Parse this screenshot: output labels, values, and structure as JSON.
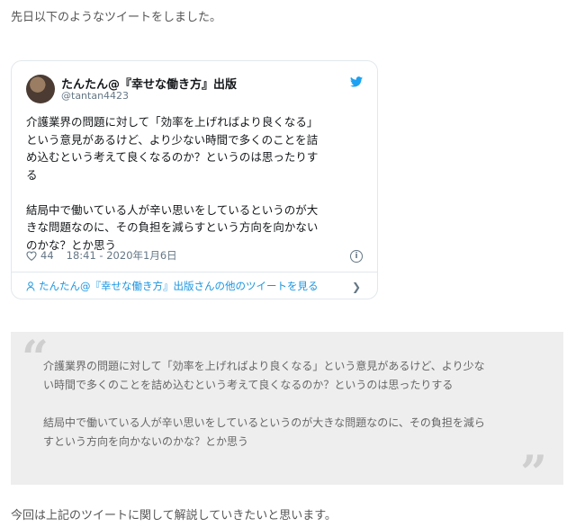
{
  "intro_text": "先日以下のようなツイートをしました。",
  "tweet": {
    "author_name": "たんたん@『幸せな働き方』出版",
    "author_handle": "@tantan4423",
    "body": "介護業界の問題に対して「効率を上げればより良くなる」\nという意見があるけど、より少ない時間で多くのことを詰\nめ込むという考えて良くなるのか？というのは思ったりす\nる\n\n結局中で働いている人が辛い思いをしているというのが大\nきな問題なのに、その負担を減らすという方向を向かない\nのかな？とか思う",
    "likes": "44",
    "timestamp": "18:41 - 2020年1月6日",
    "more_link": "たんたん@『幸せな働き方』出版さんの他のツイートを見る",
    "icons": [
      "avatar",
      "twitter-bird-icon",
      "heart-icon",
      "info-icon",
      "person-icon",
      "chevron-right-icon"
    ],
    "accent_color": "#1b95e0"
  },
  "quote": {
    "text": "介護業界の問題に対して「効率を上げればより良くなる」という意見があるけど、より少な\nい時間で多くのことを詰め込むという考えて良くなるのか？というのは思ったりする\n\n結局中で働いている人が辛い思いをしているというのが大きな問題なのに、その負担を減ら\nすという方向を向かないのかな？とか思う",
    "open_mark": "“",
    "close_mark": "”"
  },
  "outro_text": "今回は上記のツイートに関して解説していきたいと思います。"
}
